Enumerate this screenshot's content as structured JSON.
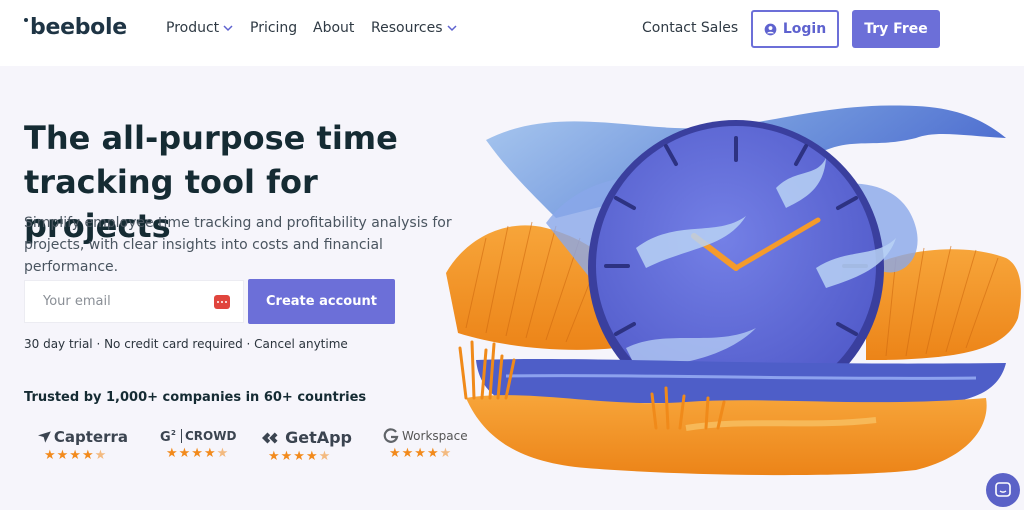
{
  "header": {
    "logo_text": "beebole",
    "nav": [
      {
        "label": "Product",
        "has_dropdown": true
      },
      {
        "label": "Pricing",
        "has_dropdown": false
      },
      {
        "label": "About",
        "has_dropdown": false
      },
      {
        "label": "Resources",
        "has_dropdown": true
      }
    ],
    "contact_label": "Contact Sales",
    "login_label": "Login",
    "login_icon": "user-circle-icon",
    "try_label": "Try Free"
  },
  "hero": {
    "headline_line1": "The all-purpose time",
    "headline_line2": "tracking tool for projects",
    "subtext": "Simplify employee time tracking and profitability analysis for projects, with clear insights into costs and financial performance.",
    "email_placeholder": "Your email",
    "email_value": "",
    "cta_label": "Create account",
    "trial_note": "30 day trial · No credit card required · Cancel anytime",
    "trusted_text": "Trusted by 1,000+ companies in 60+ countries"
  },
  "ratings": [
    {
      "brand": "Capterra",
      "icon": "capterra-logo-icon",
      "stars": 4.5
    },
    {
      "brand": "CROWD",
      "icon": "g2-logo-icon",
      "stars": 4.5
    },
    {
      "brand": "GetApp",
      "icon": "getapp-logo-icon",
      "stars": 4.5
    },
    {
      "brand": "Workspace",
      "icon": "google-g-logo-icon",
      "stars": 4.5
    }
  ],
  "colors": {
    "accent": "#6c6fd8",
    "headline": "#152b33",
    "star": "#f28a1c",
    "autofill": "#e0453d"
  }
}
